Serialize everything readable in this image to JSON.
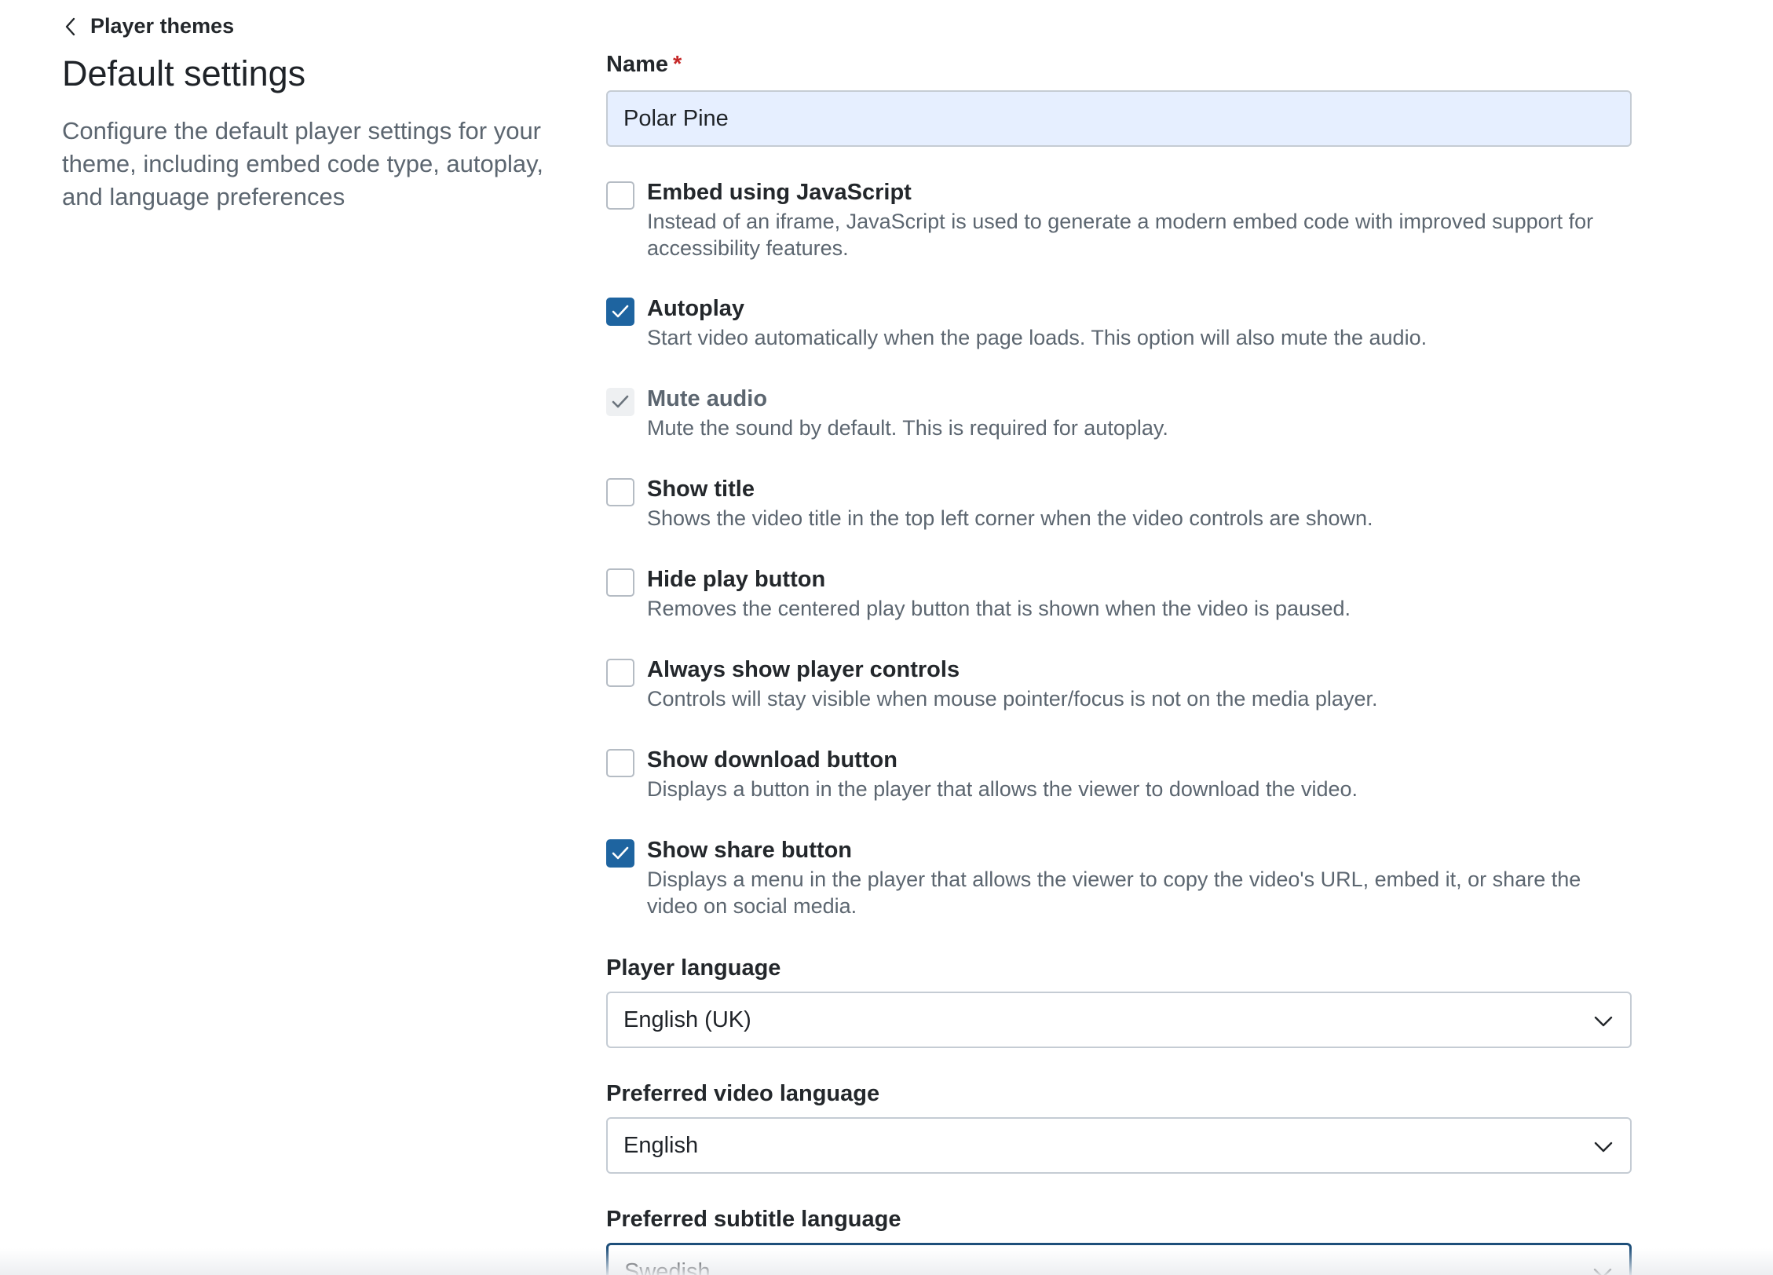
{
  "back_link": {
    "label": "Player themes",
    "icon": "chevron-left-icon"
  },
  "page": {
    "title": "Default settings",
    "description": "Configure the default player settings for your theme, including embed code type, autoplay, and language preferences"
  },
  "name_field": {
    "label": "Name",
    "required_mark": "*",
    "value": "Polar Pine"
  },
  "options": [
    {
      "title": "Embed using JavaScript",
      "description": "Instead of an iframe, JavaScript is used to generate a modern embed code with improved support for accessibility features.",
      "checked": false,
      "disabled": false
    },
    {
      "title": "Autoplay",
      "description": "Start video automatically when the page loads. This option will also mute the audio.",
      "checked": true,
      "disabled": false
    },
    {
      "title": "Mute audio",
      "description": "Mute the sound by default. This is required for autoplay.",
      "checked": true,
      "disabled": true
    },
    {
      "title": "Show title",
      "description": "Shows the video title in the top left corner when the video controls are shown.",
      "checked": false,
      "disabled": false
    },
    {
      "title": "Hide play button",
      "description": "Removes the centered play button that is shown when the video is paused.",
      "checked": false,
      "disabled": false
    },
    {
      "title": "Always show player controls",
      "description": "Controls will stay visible when mouse pointer/focus is not on the media player.",
      "checked": false,
      "disabled": false
    },
    {
      "title": "Show download button",
      "description": "Displays a button in the player that allows the viewer to download the video.",
      "checked": false,
      "disabled": false
    },
    {
      "title": "Show share button",
      "description": "Displays a menu in the player that allows the viewer to copy the video's URL, embed it, or share the video on social media.",
      "checked": true,
      "disabled": false
    }
  ],
  "player_language": {
    "label": "Player language",
    "value": "English (UK)"
  },
  "video_language": {
    "label": "Preferred video language",
    "value": "English"
  },
  "subtitle_language": {
    "label": "Preferred subtitle language",
    "value": "Swedish"
  },
  "colors": {
    "accent": "#1e64a0",
    "input_bg": "#e6efff",
    "required": "#c62828",
    "muted_text": "#5c6670"
  }
}
